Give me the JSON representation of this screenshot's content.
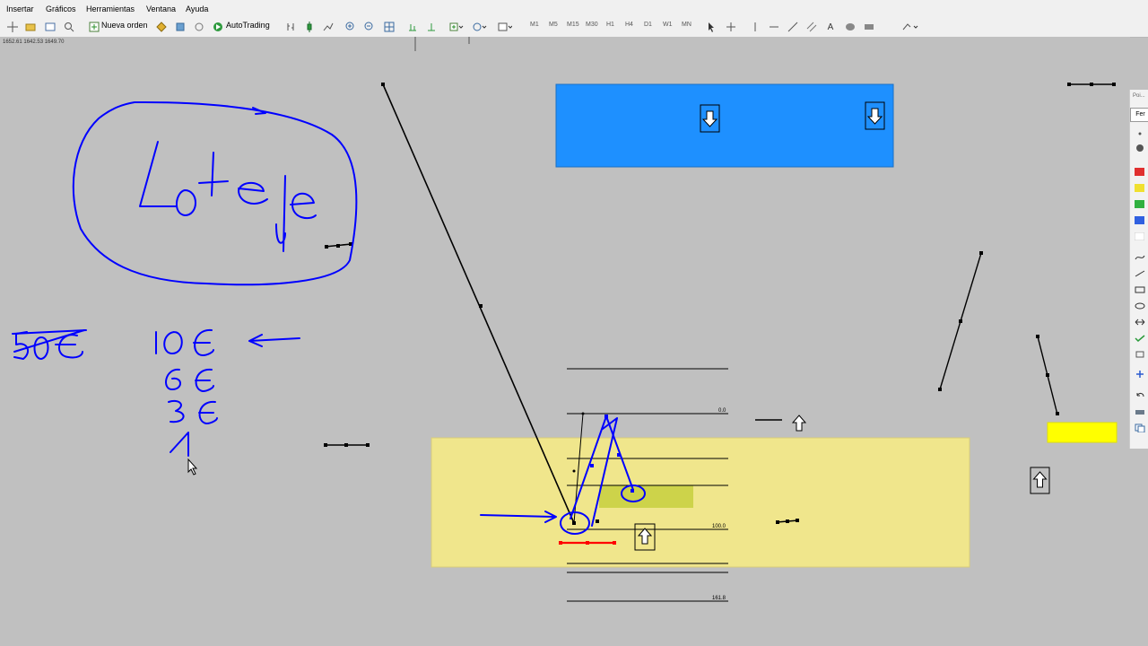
{
  "menu": [
    "Insertar",
    "Gráficos",
    "Herramientas",
    "Ventana",
    "Ayuda"
  ],
  "toolbar": {
    "new_order": "Nueva orden",
    "autotrading": "AutoTrading",
    "timeframes": [
      "M1",
      "M5",
      "M15",
      "M30",
      "H1",
      "H4",
      "D1",
      "W1",
      "MN"
    ],
    "text_tool": "A"
  },
  "quote_line": "1652.61 1642.53 1649.70",
  "fib_labels": {
    "level_0": "0.0",
    "level_100": "100.0",
    "level_161": "161.8"
  },
  "right_panel": {
    "title_top": "Poi...",
    "title_tab": "Fer"
  },
  "colors": {
    "blue_rect": "#1e90ff",
    "yellow_zone": "#f0e68c",
    "bright_yellow": "#ffff00",
    "pen": "#0000ff",
    "red_line": "#ff0000"
  },
  "icons": [
    "crosshair-icon",
    "folder-icon",
    "zoom-icon",
    "new-order-icon",
    "autotrading-icon",
    "cursor-icon",
    "line-tool-icon",
    "arrow-down-icon",
    "arrow-up-icon"
  ]
}
